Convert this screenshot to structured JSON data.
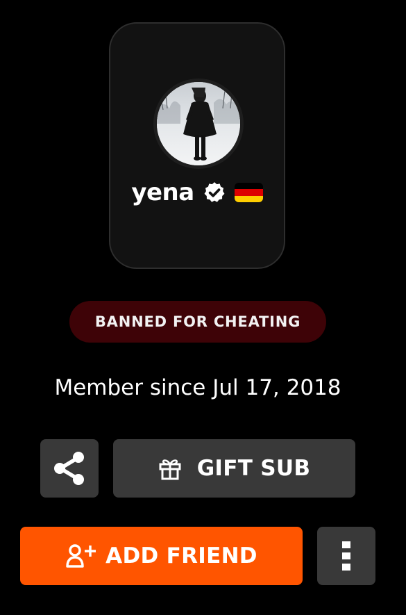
{
  "profile": {
    "username": "yena",
    "verified_icon": "verified-badge-icon",
    "country_flag": {
      "icon": "germany-flag-icon",
      "colors": [
        "#000000",
        "#dd0000",
        "#ffce00"
      ]
    },
    "avatar": "profile-avatar-photo"
  },
  "status_badge": {
    "label": "BANNED FOR CHEATING",
    "background": "#3e0307"
  },
  "member_since": "Member since Jul 17, 2018",
  "actions": {
    "share": {
      "icon": "share-icon"
    },
    "gift_sub": {
      "label": "GIFT SUB",
      "icon": "gift-icon"
    },
    "add_friend": {
      "label": "ADD FRIEND",
      "icon": "add-user-icon",
      "background": "#ff5500"
    },
    "more": {
      "icon": "more-vertical-icon"
    }
  },
  "colors": {
    "page_background": "#000000",
    "card_background": "#121212",
    "button_background": "#393939",
    "accent": "#ff5500"
  }
}
